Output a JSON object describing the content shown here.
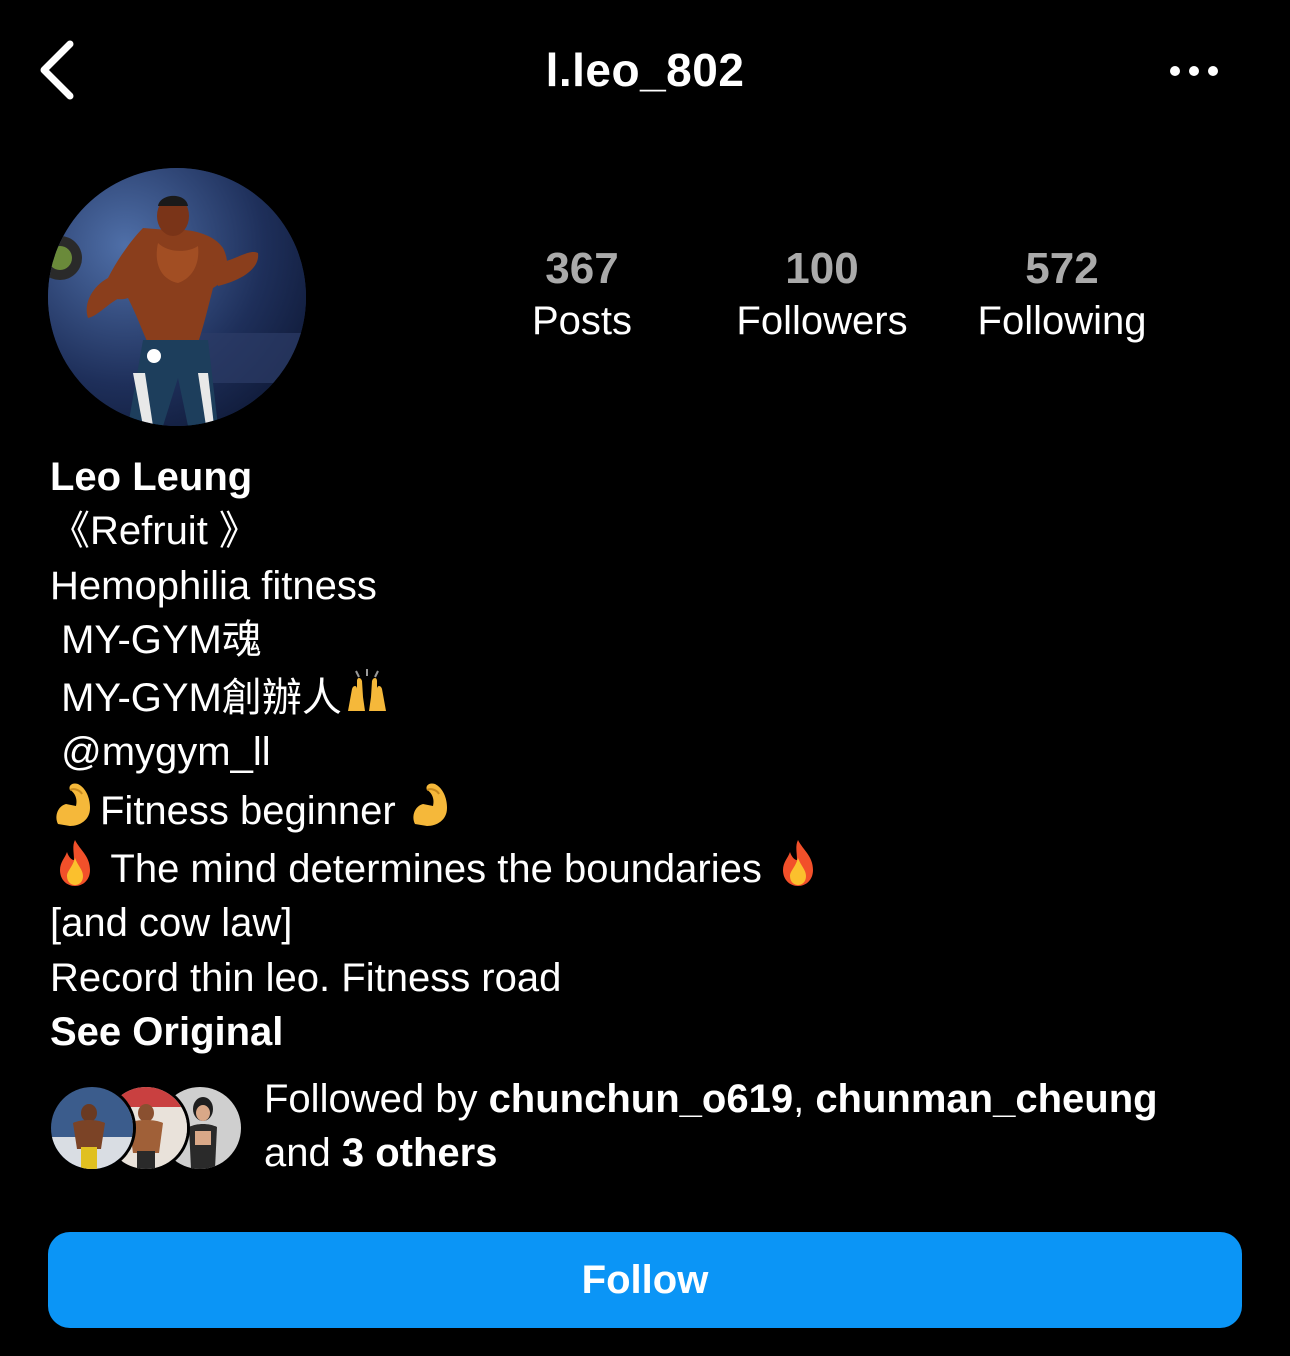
{
  "header": {
    "username": "l.leo_802",
    "back_icon": "chevron-left-icon",
    "more_icon": "more-horizontal-icon"
  },
  "stats": {
    "posts_count": "367",
    "posts_label": "Posts",
    "followers_count": "100",
    "followers_label": "Followers",
    "following_count": "572",
    "following_label": "Following"
  },
  "bio": {
    "name": "Leo Leung",
    "line1": "《Refruit 》",
    "line2": "Hemophilia fitness",
    "line3": " MY-GYM魂",
    "line4": " MY-GYM創辦人",
    "line5": " @mygym_ll",
    "line6": "Fitness beginner ",
    "line7": " The mind determines the boundaries ",
    "line8": "[and cow law]",
    "line9": "Record thin leo. Fitness road",
    "see_original": "See Original"
  },
  "followed_by": {
    "prefix": "Followed by ",
    "user1": "chunchun_o619",
    "separator": ", ",
    "user2": "chunman_cheung",
    "and_text": "and ",
    "others": "3 others"
  },
  "follow_button": {
    "label": "Follow"
  },
  "colors": {
    "background": "#000000",
    "accent": "#0b95f6",
    "stat_number": "#aaaaaa"
  }
}
